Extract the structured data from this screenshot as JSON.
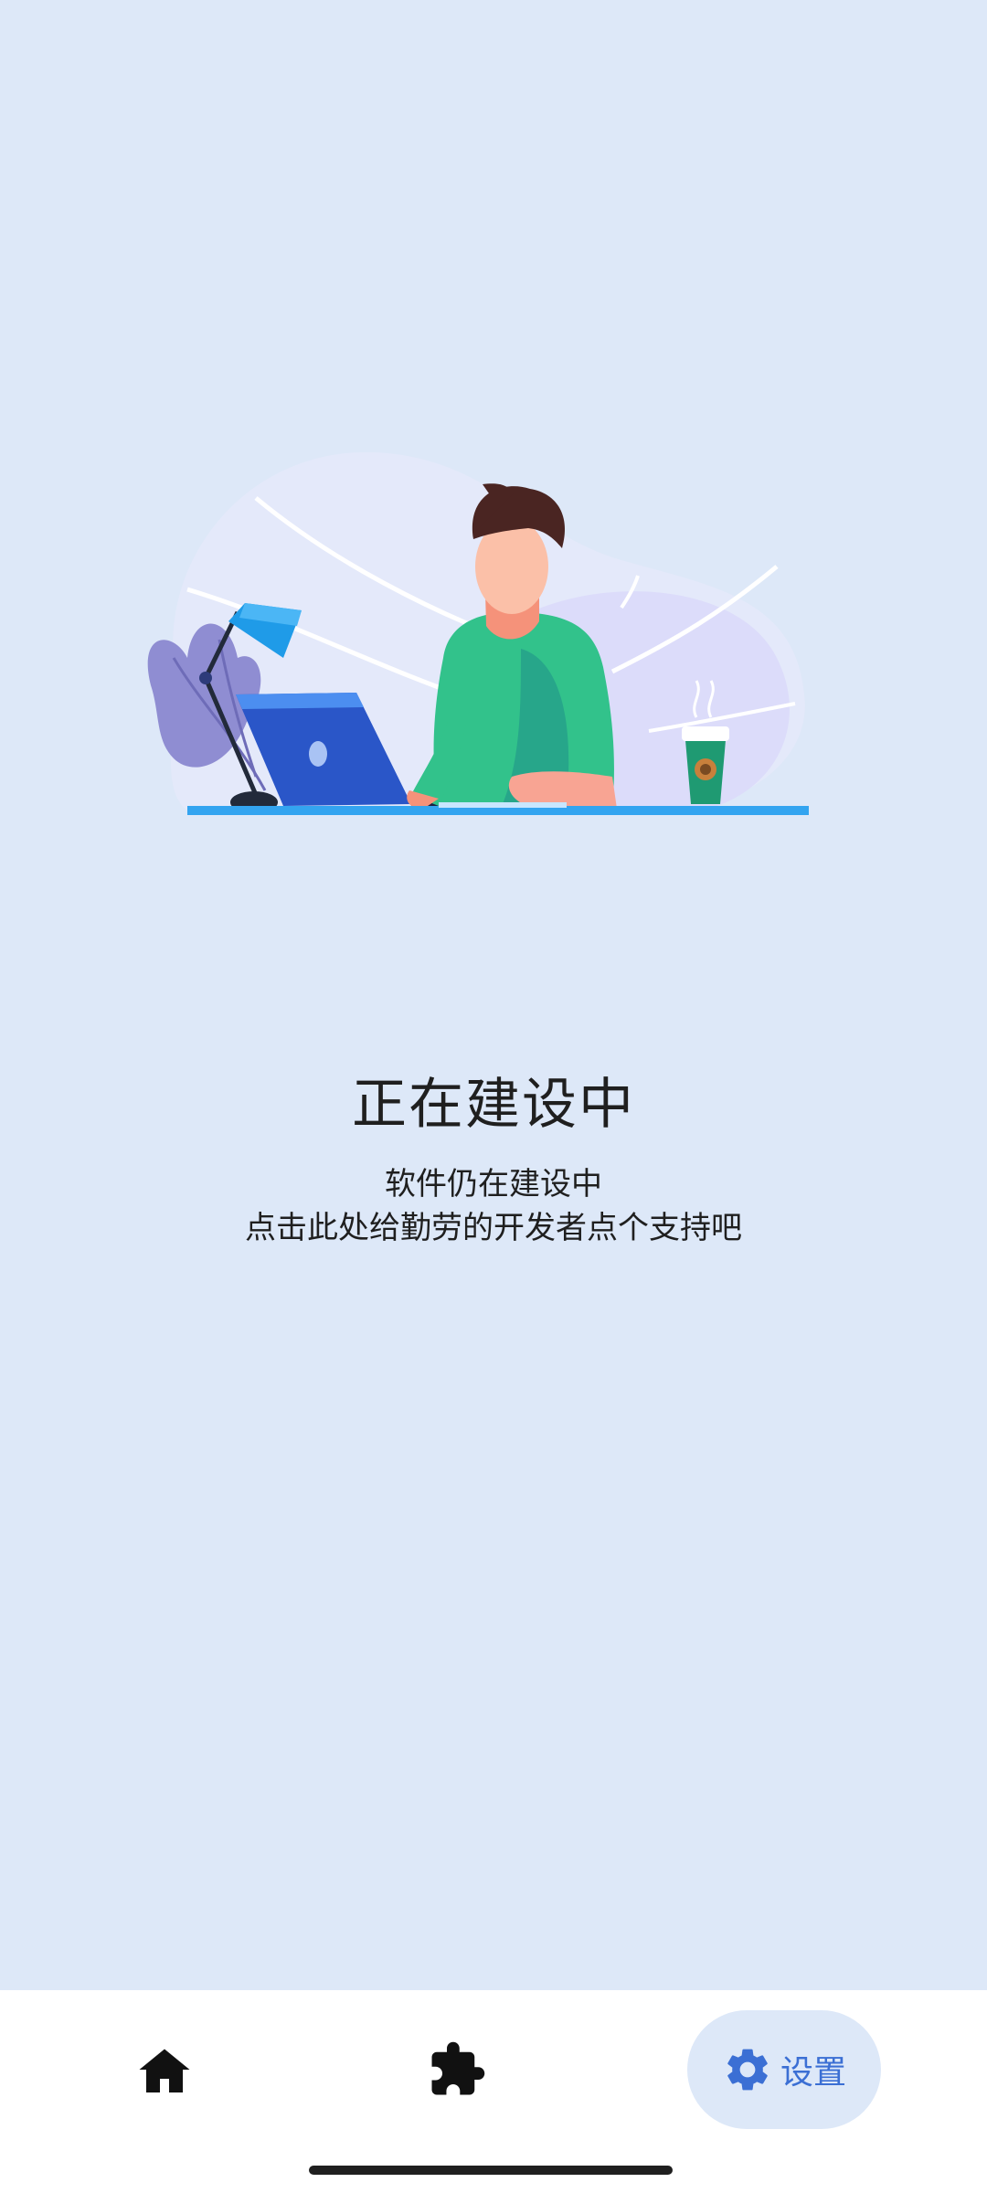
{
  "main": {
    "title": "正在建设中",
    "subtitle_line1": "软件仍在建设中",
    "subtitle_line2": "点击此处给勤劳的开发者点个支持吧"
  },
  "bottom_nav": {
    "items": [
      {
        "icon": "home-icon",
        "label": ""
      },
      {
        "icon": "puzzle-icon",
        "label": ""
      },
      {
        "icon": "gear-icon",
        "label": "设置",
        "selected": true
      }
    ]
  },
  "colors": {
    "background": "#dde8f8",
    "nav_background": "#ffffff",
    "accent": "#3b6fd4"
  }
}
